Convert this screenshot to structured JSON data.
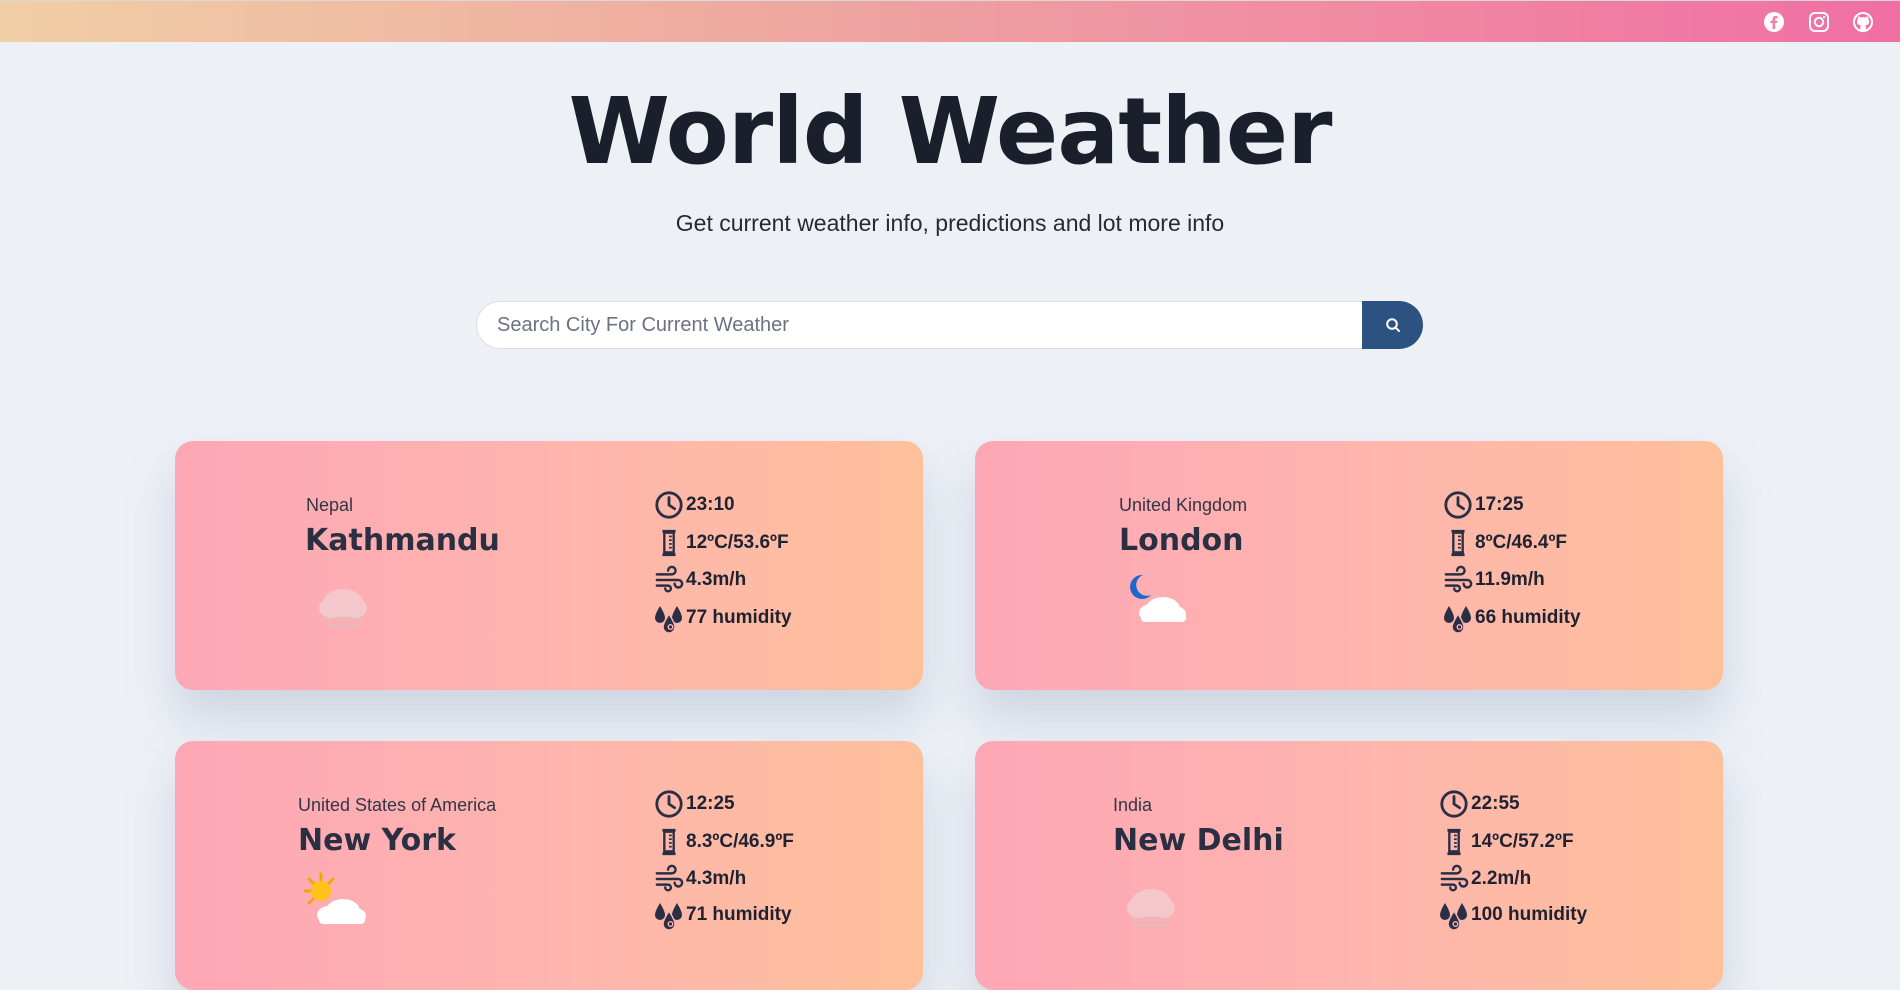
{
  "header": {
    "social": [
      {
        "icon": "facebook-icon"
      },
      {
        "icon": "instagram-icon"
      },
      {
        "icon": "github-icon"
      }
    ],
    "gradient": [
      "#f1cfa5",
      "#f06fa3"
    ]
  },
  "hero": {
    "title": "World Weather",
    "subtitle": "Get current weather info, predictions and lot more info"
  },
  "search": {
    "placeholder": "Search City For Current Weather",
    "value": "",
    "button_icon": "search-icon",
    "button_color": "#2c5282"
  },
  "cards": [
    {
      "country": "Nepal",
      "city": "Kathmandu",
      "weather_icon": "fog-cloud-icon",
      "time": "23:10",
      "temp": "12ºC/53.6ºF",
      "wind": "4.3m/h",
      "humidity": "77 humidity"
    },
    {
      "country": "United Kingdom",
      "city": "London",
      "weather_icon": "night-cloud-icon",
      "time": "17:25",
      "temp": "8ºC/46.4ºF",
      "wind": "11.9m/h",
      "humidity": "66 humidity"
    },
    {
      "country": "United States of America",
      "city": "New York",
      "weather_icon": "sun-cloud-icon",
      "time": "12:25",
      "temp": "8.3ºC/46.9ºF",
      "wind": "4.3m/h",
      "humidity": "71 humidity"
    },
    {
      "country": "India",
      "city": "New Delhi",
      "weather_icon": "fog-cloud-icon",
      "time": "22:55",
      "temp": "14ºC/57.2ºF",
      "wind": "2.2m/h",
      "humidity": "100 humidity"
    }
  ]
}
